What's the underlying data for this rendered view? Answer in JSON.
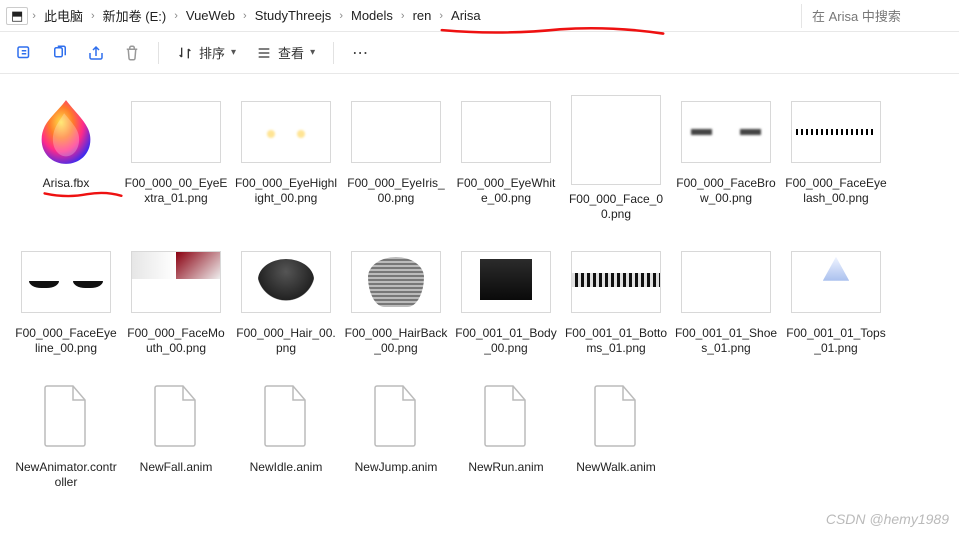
{
  "breadcrumb": {
    "items": [
      "此电脑",
      "新加卷 (E:)",
      "VueWeb",
      "StudyThreejs",
      "Models",
      "ren",
      "Arisa"
    ]
  },
  "search": {
    "placeholder": "在 Arisa 中搜索"
  },
  "toolbar": {
    "sort_label": "排序",
    "view_label": "查看"
  },
  "files": [
    {
      "name": "Arisa.fbx",
      "thumb": "flame",
      "red_underline": true
    },
    {
      "name": "F00_000_00_EyeExtra_01.png",
      "thumb": "black"
    },
    {
      "name": "F00_000_EyeHighlight_00.png",
      "thumb": "highlight"
    },
    {
      "name": "F00_000_EyeIris_00.png",
      "thumb": "iris"
    },
    {
      "name": "F00_000_EyeWhite_00.png",
      "thumb": "eyewhite"
    },
    {
      "name": "F00_000_Face_00.png",
      "thumb": "face"
    },
    {
      "name": "F00_000_FaceBrow_00.png",
      "thumb": "facebrow"
    },
    {
      "name": "F00_000_FaceEyelash_00.png",
      "thumb": "eyelash"
    },
    {
      "name": "F00_000_FaceEyeline_00.png",
      "thumb": "eyeline"
    },
    {
      "name": "F00_000_FaceMouth_00.png",
      "thumb": "mouth"
    },
    {
      "name": "F00_000_Hair_00.png",
      "thumb": "hair"
    },
    {
      "name": "F00_000_HairBack_00.png",
      "thumb": "hairback"
    },
    {
      "name": "F00_001_01_Body_00.png",
      "thumb": "body"
    },
    {
      "name": "F00_001_01_Bottoms_01.png",
      "thumb": "bottoms"
    },
    {
      "name": "F00_001_01_Shoes_01.png",
      "thumb": "shoes"
    },
    {
      "name": "F00_001_01_Tops_01.png",
      "thumb": "tops"
    },
    {
      "name": "NewAnimator.controller",
      "thumb": "doc"
    },
    {
      "name": "NewFall.anim",
      "thumb": "doc"
    },
    {
      "name": "NewIdle.anim",
      "thumb": "doc"
    },
    {
      "name": "NewJump.anim",
      "thumb": "doc"
    },
    {
      "name": "NewRun.anim",
      "thumb": "doc"
    },
    {
      "name": "NewWalk.anim",
      "thumb": "doc"
    }
  ],
  "watermark": "CSDN @hemy1989"
}
